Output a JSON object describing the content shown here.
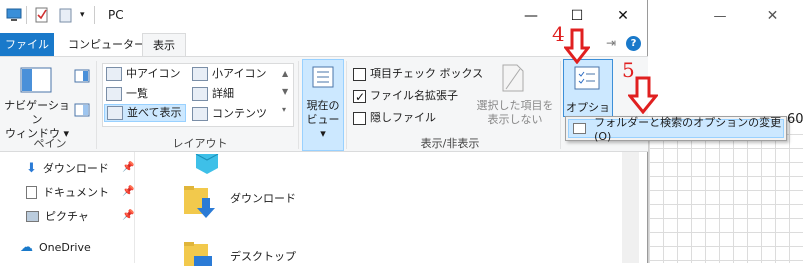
{
  "window": {
    "title": "PC",
    "minimize_glyph": "—",
    "maximize_glyph": "☐",
    "close_glyph": "✕"
  },
  "tabs": [
    "ファイル",
    "コンピューター",
    "表示"
  ],
  "ribbon": {
    "pane_group": {
      "label": "ペイン",
      "nav_pane_line1": "ナビゲーション",
      "nav_pane_line2": "ウィンドウ ▾"
    },
    "layout_group": {
      "label": "レイアウト",
      "items": [
        "中アイコン",
        "小アイコン",
        "一覧",
        "詳細",
        "並べて表示",
        "コンテンツ"
      ]
    },
    "current_view": {
      "line1": "現在の",
      "line2": "ビュー ▾"
    },
    "showhide_group": {
      "label": "表示/非表示",
      "item_checkbox": "項目チェック ボックス",
      "file_ext": "ファイル名拡張子",
      "hidden_files": "隠しファイル",
      "hide_selected_line1": "選択した項目を",
      "hide_selected_line2": "表示しない"
    },
    "options_label": "オプション"
  },
  "menu": {
    "folder_options": "フォルダーと検索のオプションの変更(O)"
  },
  "nav_items": [
    {
      "label": "ダウンロード",
      "icon": "download-icon"
    },
    {
      "label": "ドキュメント",
      "icon": "documents-icon"
    },
    {
      "label": "ピクチャ",
      "icon": "pictures-icon"
    },
    {
      "label": "OneDrive",
      "icon": "onedrive-icon"
    }
  ],
  "content_items": [
    {
      "label": "ダウンロード"
    },
    {
      "label": "デスクトップ"
    }
  ],
  "annotations": {
    "step4": "4",
    "step5": "5"
  },
  "background_snippet": "60",
  "colors": {
    "file_tab": "#1979ca",
    "ribbon_bg": "#f5f6f7",
    "menu_highlight": "#cce8ff",
    "annotation_red": "#e02020"
  }
}
